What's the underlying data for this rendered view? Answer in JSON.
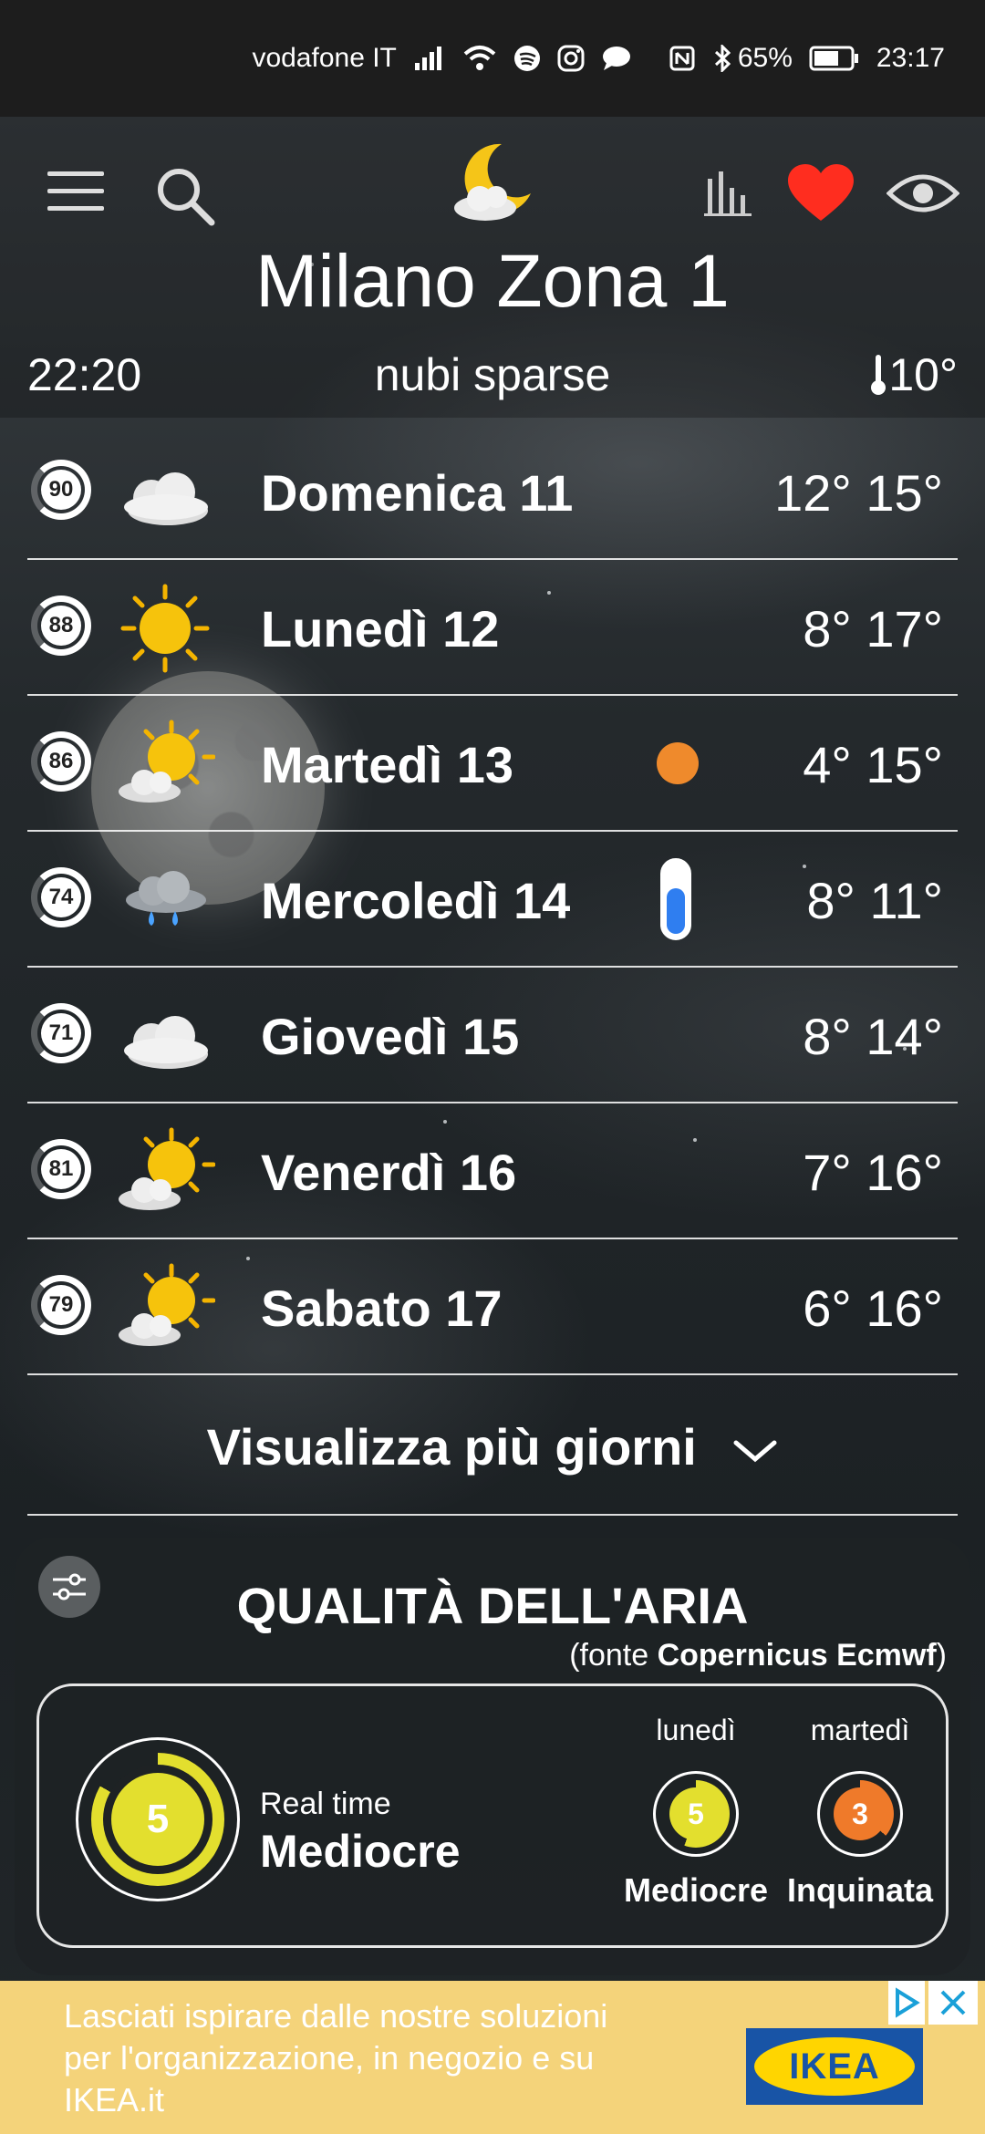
{
  "status_bar": {
    "carrier": "vodafone IT",
    "battery": "65%",
    "time": "23:17"
  },
  "header": {
    "city": "Milano Zona 1",
    "time": "22:20",
    "condition": "nubi sparse",
    "temperature": "10°",
    "icons": [
      "menu-icon",
      "search-icon",
      "moon-cloud-icon",
      "chart-icon",
      "heart-icon",
      "eye-icon"
    ],
    "heart_color": "#ff2d1f"
  },
  "forecast": [
    {
      "score": "90",
      "day": "Domenica 11",
      "min": "12°",
      "max": "15°",
      "icon": "cloudy"
    },
    {
      "score": "88",
      "day": "Lunedì 12",
      "min": "8°",
      "max": "17°",
      "icon": "sunny"
    },
    {
      "score": "86",
      "day": "Martedì 13",
      "min": "4°",
      "max": "15°",
      "icon": "partly-sunny"
    },
    {
      "score": "74",
      "day": "Mercoledì 14",
      "min": "8°",
      "max": "11°",
      "icon": "rain"
    },
    {
      "score": "71",
      "day": "Giovedì 15",
      "min": "8°",
      "max": "14°",
      "icon": "cloudy"
    },
    {
      "score": "81",
      "day": "Venerdì 16",
      "min": "7°",
      "max": "16°",
      "icon": "partly-sunny"
    },
    {
      "score": "79",
      "day": "Sabato 17",
      "min": "6°",
      "max": "16°",
      "icon": "partly-sunny"
    }
  ],
  "more_days": "Visualizza più giorni",
  "air_quality": {
    "title": "QUALITÀ DELL'ARIA",
    "source_prefix": "(fonte ",
    "source_name": "Copernicus Ecmwf",
    "source_suffix": ")",
    "realtime_label": "Real time",
    "realtime_value": "5",
    "realtime_status": "Mediocre",
    "days": [
      {
        "name": "lunedì",
        "value": "5",
        "status": "Mediocre",
        "color": "#e3df2e"
      },
      {
        "name": "martedì",
        "value": "3",
        "status": "Inquinata",
        "color": "#ef7a2a"
      }
    ]
  },
  "ad": {
    "text": "Lasciati ispirare dalle nostre soluzioni per l'organizzazione, in negozio e su IKEA.it",
    "brand": "IKEA"
  }
}
